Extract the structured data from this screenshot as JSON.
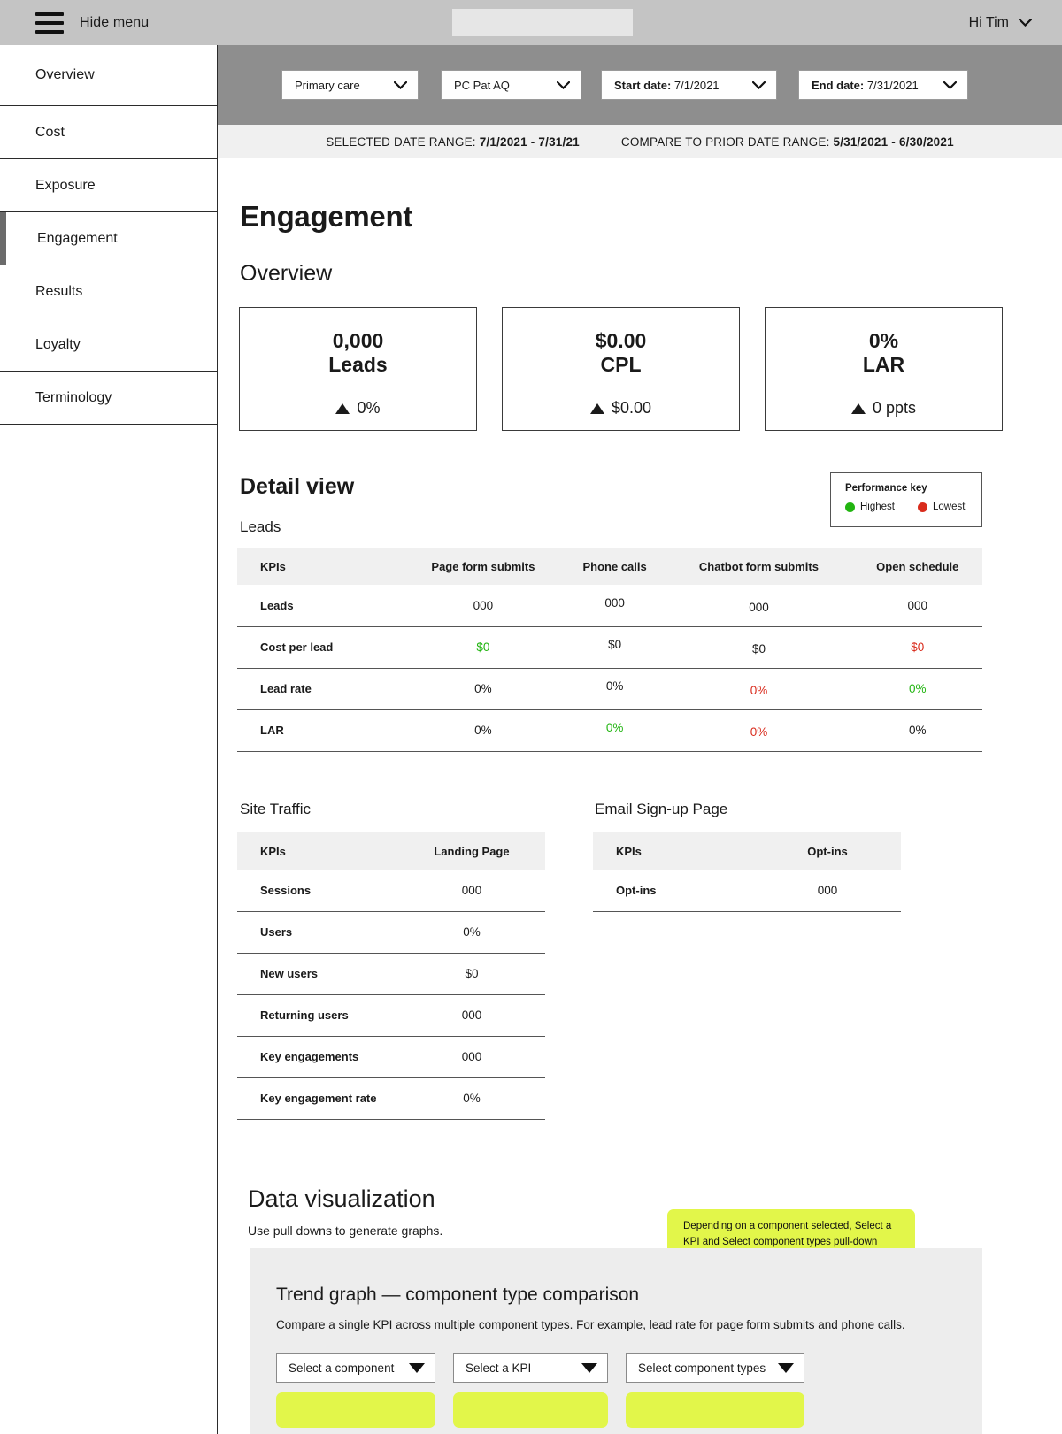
{
  "topbar": {
    "hide_menu_label": "Hide menu",
    "search_value": "",
    "search_placeholder": "",
    "user_greeting": "Hi Tim"
  },
  "sidebar": {
    "items": [
      {
        "label": "Overview",
        "active": false
      },
      {
        "label": "Cost",
        "active": false
      },
      {
        "label": "Exposure",
        "active": false
      },
      {
        "label": "Engagement",
        "active": true
      },
      {
        "label": "Results",
        "active": false
      },
      {
        "label": "Loyalty",
        "active": false
      },
      {
        "label": "Terminology",
        "active": false
      }
    ]
  },
  "filters": {
    "practice": "Primary care",
    "program": "PC Pat AQ",
    "start_label": "Start date:",
    "start_value": "7/1/2021",
    "end_label": "End date:",
    "end_value": "7/31/2021"
  },
  "date_range": {
    "selected_label": "SELECTED DATE RANGE:",
    "selected_value": "7/1/2021 - 7/31/21",
    "compare_label": "COMPARE TO PRIOR DATE RANGE:",
    "compare_value": "5/31/2021 - 6/30/2021"
  },
  "page": {
    "title": "Engagement",
    "overview_heading": "Overview",
    "detail_heading": "Detail view"
  },
  "kpi_cards": [
    {
      "value": "0,000",
      "label": "Leads",
      "delta": "0%"
    },
    {
      "value": "$0.00",
      "label": "CPL",
      "delta": "$0.00"
    },
    {
      "value": "0%",
      "label": "LAR",
      "delta": "0 ppts"
    }
  ],
  "performance_key": {
    "title": "Performance key",
    "highest_label": "Highest",
    "lowest_label": "Lowest",
    "highest_color": "#22b511",
    "lowest_color": "#d92b1c"
  },
  "leads_table": {
    "caption": "Leads",
    "headers": [
      "KPIs",
      "Page form submits",
      "Phone calls",
      "Chatbot form submits",
      "Open schedule"
    ],
    "rows": [
      {
        "kpi": "Leads",
        "cells": [
          {
            "v": "000",
            "c": "none"
          },
          {
            "v": "000",
            "c": "none"
          },
          {
            "v": "000",
            "c": "none"
          },
          {
            "v": "000",
            "c": "none"
          }
        ]
      },
      {
        "kpi": "Cost per lead",
        "cells": [
          {
            "v": "$0",
            "c": "green"
          },
          {
            "v": "$0",
            "c": "none"
          },
          {
            "v": "$0",
            "c": "none"
          },
          {
            "v": "$0",
            "c": "red"
          }
        ]
      },
      {
        "kpi": "Lead rate",
        "cells": [
          {
            "v": "0%",
            "c": "none"
          },
          {
            "v": "0%",
            "c": "none"
          },
          {
            "v": "0%",
            "c": "red"
          },
          {
            "v": "0%",
            "c": "green"
          }
        ]
      },
      {
        "kpi": "LAR",
        "cells": [
          {
            "v": "0%",
            "c": "none"
          },
          {
            "v": "0%",
            "c": "green"
          },
          {
            "v": "0%",
            "c": "red"
          },
          {
            "v": "0%",
            "c": "none"
          }
        ]
      }
    ]
  },
  "site_traffic_table": {
    "caption": "Site Traffic",
    "headers": [
      "KPIs",
      "Landing Page"
    ],
    "rows": [
      {
        "kpi": "Sessions",
        "value": "000"
      },
      {
        "kpi": "Users",
        "value": "0%"
      },
      {
        "kpi": "New users",
        "value": "$0"
      },
      {
        "kpi": "Returning users",
        "value": "000"
      },
      {
        "kpi": "Key engagements",
        "value": "000"
      },
      {
        "kpi": "Key engagement rate",
        "value": "0%"
      }
    ]
  },
  "email_signup_table": {
    "caption": "Email Sign-up Page",
    "headers": [
      "KPIs",
      "Opt-ins"
    ],
    "rows": [
      {
        "kpi": "Opt-ins",
        "value": "000"
      }
    ]
  },
  "data_visualization": {
    "title": "Data visualization",
    "subtitle": "Use pull downs to generate graphs.",
    "callout": "Depending on a component selected, Select a KPI and Select component types pull-down items change dynamically.",
    "callout_color": "#e2f64a",
    "panel": {
      "title": "Trend graph — component type comparison",
      "description": "Compare a single KPI across multiple component types. For example, lead rate for page form submits and phone calls.",
      "selects": [
        "Select a component",
        "Select a KPI",
        "Select component types"
      ]
    }
  }
}
